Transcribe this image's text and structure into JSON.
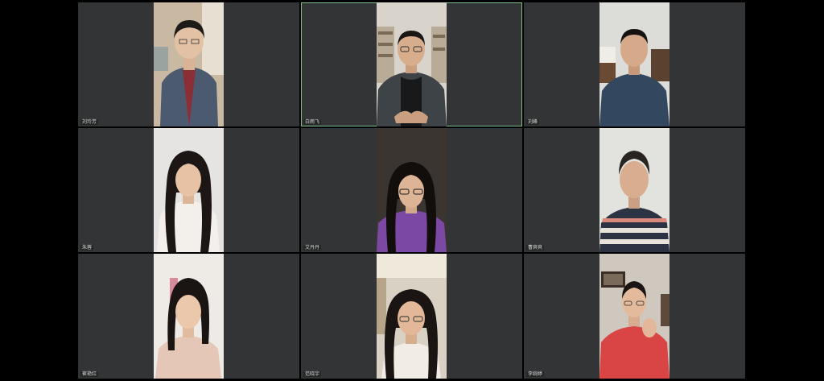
{
  "window": {
    "title": ""
  },
  "participants": [
    {
      "name": "刘玲芳",
      "active": false,
      "scene": "man-denim"
    },
    {
      "name": "白雨飞",
      "active": true,
      "scene": "man-bookshelf"
    },
    {
      "name": "刘峰",
      "active": false,
      "scene": "man-office"
    },
    {
      "name": "朱蓉",
      "active": false,
      "scene": "woman-long-hair"
    },
    {
      "name": "艾丹丹",
      "active": false,
      "scene": "woman-glasses-purple"
    },
    {
      "name": "曹爽爽",
      "active": false,
      "scene": "woman-striped"
    },
    {
      "name": "崔艳红",
      "active": false,
      "scene": "woman-pink"
    },
    {
      "name": "范晓宇",
      "active": false,
      "scene": "woman-glasses-window"
    },
    {
      "name": "李婉婷",
      "active": false,
      "scene": "woman-red-hoodie"
    }
  ],
  "colors": {
    "tile_bg": "#333435",
    "active_border": "#7fc08e",
    "page_bg": "#000000"
  }
}
